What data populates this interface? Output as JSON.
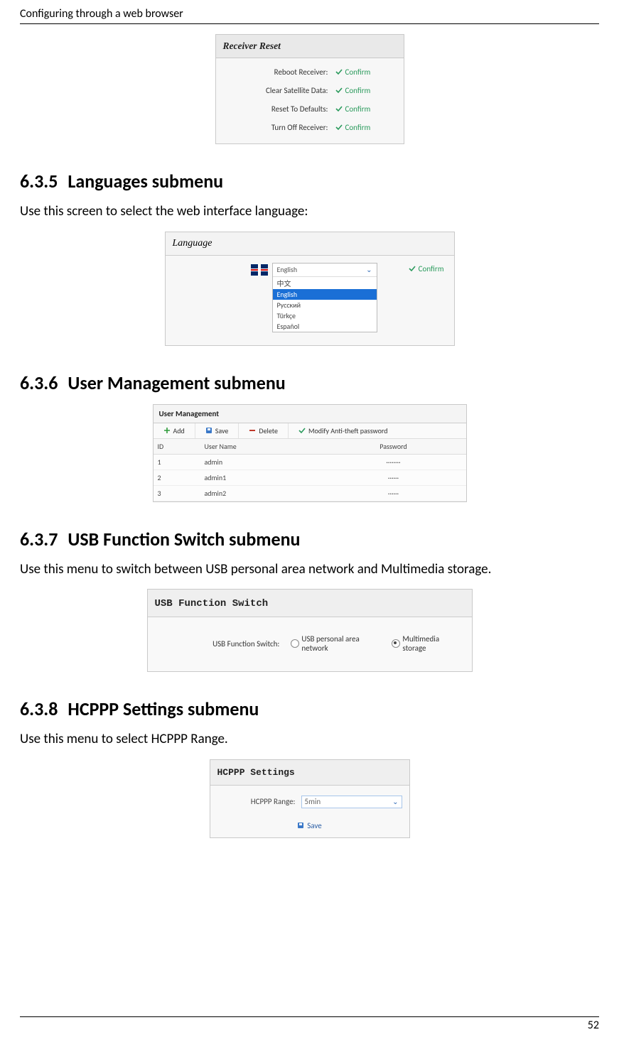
{
  "running_head": "Configuring through a web browser",
  "page_number": "52",
  "receiver_reset": {
    "title": "Receiver Reset",
    "rows": [
      {
        "label": "Reboot Receiver:",
        "action": "Confirm"
      },
      {
        "label": "Clear Satellite Data:",
        "action": "Confirm"
      },
      {
        "label": "Reset To Defaults:",
        "action": "Confirm"
      },
      {
        "label": "Turn Off Receiver:",
        "action": "Confirm"
      }
    ]
  },
  "sec_635": {
    "num": "6.3.5",
    "title": "Languages submenu",
    "body": "Use this screen to select the web interface language:"
  },
  "language_panel": {
    "title": "Language",
    "selected": "English",
    "options": [
      "中文",
      "English",
      "Русский",
      "Türkçe",
      "Español"
    ],
    "confirm": "Confirm"
  },
  "sec_636": {
    "num": "6.3.6",
    "title": "User Management submenu"
  },
  "user_mgmt": {
    "title": "User Management",
    "toolbar": {
      "add": "Add",
      "save": "Save",
      "delete": "Delete",
      "modify": "Modify Anti-theft password"
    },
    "head": {
      "id": "ID",
      "user": "User Name",
      "pwd": "Password"
    },
    "rows": [
      {
        "id": "1",
        "user": "admin",
        "pwd": "········"
      },
      {
        "id": "2",
        "user": "admin1",
        "pwd": "······"
      },
      {
        "id": "3",
        "user": "admin2",
        "pwd": "······"
      }
    ]
  },
  "sec_637": {
    "num": "6.3.7",
    "title": "USB Function Switch submenu",
    "body": "Use this menu to switch between USB personal area network and Multimedia storage."
  },
  "usb_panel": {
    "title": "USB Function Switch",
    "label": "USB Function Switch:",
    "opt1": "USB personal area network",
    "opt2": "Multimedia storage",
    "selected": "opt2"
  },
  "sec_638": {
    "num": "6.3.8",
    "title": "HCPPP Settings submenu",
    "body": "Use this menu to select HCPPP Range."
  },
  "hcppp_panel": {
    "title": "HCPPP Settings",
    "label": "HCPPP Range:",
    "value": "5min",
    "save": "Save"
  }
}
